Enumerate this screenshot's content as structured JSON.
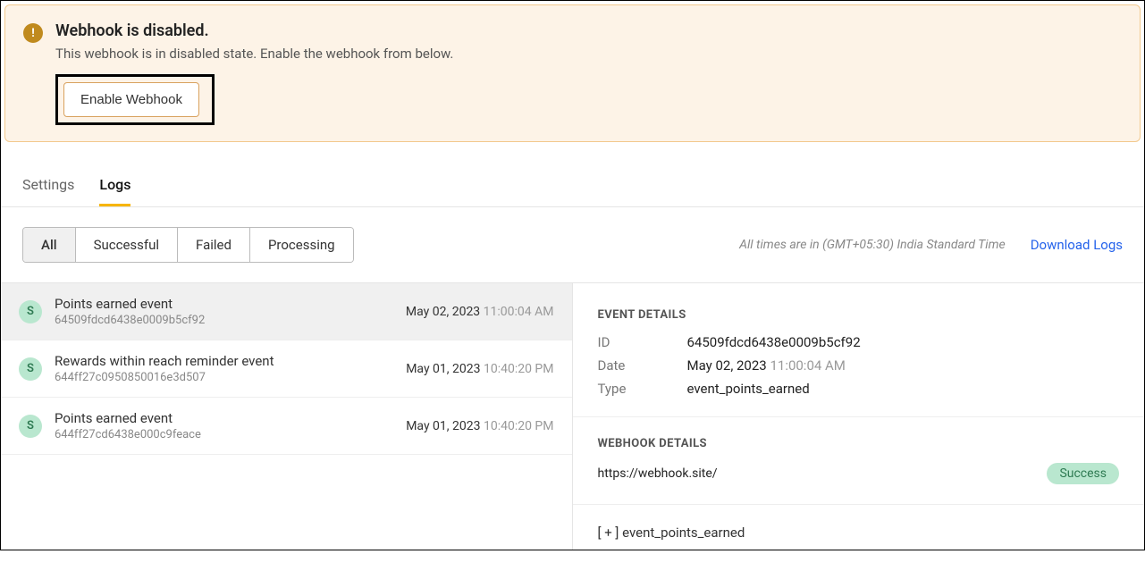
{
  "alert": {
    "title": "Webhook is disabled.",
    "description": "This webhook is in disabled state. Enable the webhook from below.",
    "button": "Enable Webhook"
  },
  "tabs": {
    "settings": "Settings",
    "logs": "Logs",
    "active": "Logs"
  },
  "filters": {
    "all": "All",
    "successful": "Successful",
    "failed": "Failed",
    "processing": "Processing",
    "active": "All"
  },
  "meta": {
    "timezone_note": "All times are in (GMT+05:30) India Standard Time",
    "download": "Download Logs"
  },
  "logs": [
    {
      "badge": "S",
      "title": "Points earned event",
      "id": "64509fdcd6438e0009b5cf92",
      "date": "May 02, 2023",
      "time": "11:00:04 AM",
      "selected": true
    },
    {
      "badge": "S",
      "title": "Rewards within reach reminder event",
      "id": "644ff27c0950850016e3d507",
      "date": "May 01, 2023",
      "time": "10:40:20 PM",
      "selected": false
    },
    {
      "badge": "S",
      "title": "Points earned event",
      "id": "644ff27cd6438e000c9feace",
      "date": "May 01, 2023",
      "time": "10:40:20 PM",
      "selected": false
    }
  ],
  "details": {
    "event_header": "EVENT DETAILS",
    "id_label": "ID",
    "id_value": "64509fdcd6438e0009b5cf92",
    "date_label": "Date",
    "date_value": "May 02, 2023",
    "date_time": "11:00:04 AM",
    "type_label": "Type",
    "type_value": "event_points_earned",
    "webhook_header": "WEBHOOK DETAILS",
    "webhook_url": "https://webhook.site/",
    "status": "Success",
    "payload": "[ + ]  event_points_earned"
  }
}
